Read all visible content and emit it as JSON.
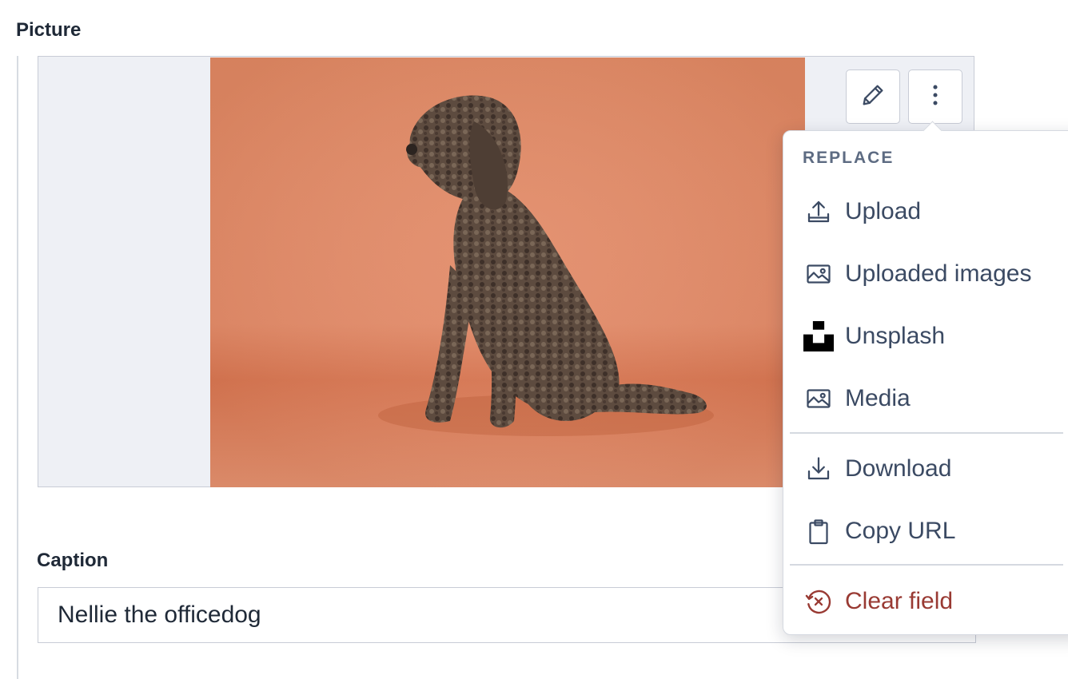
{
  "picture_field": {
    "label": "Picture"
  },
  "caption_field": {
    "label": "Caption",
    "value": "Nellie the officedog"
  },
  "toolbar": {
    "edit_icon": "pencil-icon",
    "more_icon": "kebab-menu-icon"
  },
  "menu": {
    "heading": "REPLACE",
    "replace_items": [
      {
        "label": "Upload",
        "icon": "upload-icon"
      },
      {
        "label": "Uploaded images",
        "icon": "image-icon"
      },
      {
        "label": "Unsplash",
        "icon": "unsplash-icon"
      },
      {
        "label": "Media",
        "icon": "image-icon"
      }
    ],
    "action_items": [
      {
        "label": "Download",
        "icon": "download-icon"
      },
      {
        "label": "Copy URL",
        "icon": "clipboard-icon"
      }
    ],
    "danger_items": [
      {
        "label": "Clear field",
        "icon": "clear-icon",
        "color": "#993a33"
      }
    ]
  },
  "colors": {
    "photo_background": "#e08563",
    "dog": "#5b4a3e",
    "frame_background": "#eef0f5"
  }
}
